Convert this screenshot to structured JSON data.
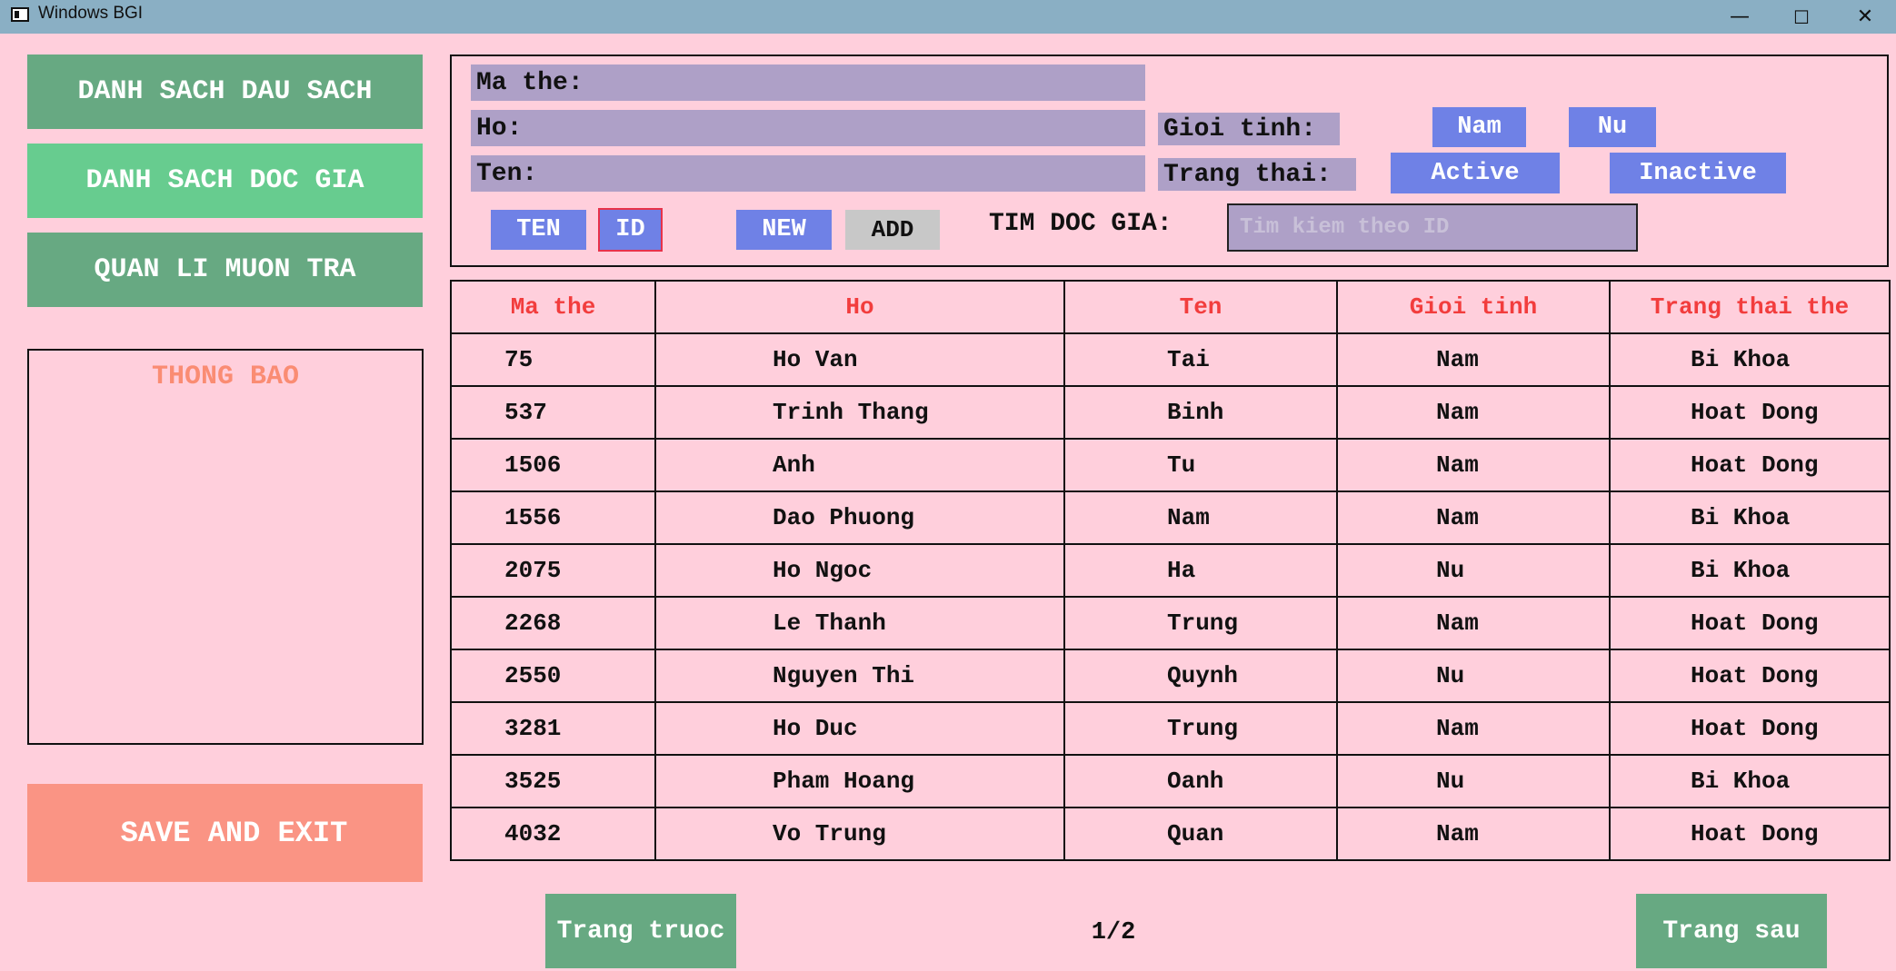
{
  "window": {
    "title": "Windows BGI",
    "minimize": "—",
    "maximize": "☐",
    "close": "✕"
  },
  "sidebar": {
    "nav": [
      "DANH SACH DAU SACH",
      "DANH SACH DOC GIA",
      "QUAN LI MUON TRA"
    ],
    "notify_title": "THONG BAO",
    "save_exit": "SAVE AND EXIT"
  },
  "form": {
    "ma_the_label": "Ma the:",
    "ho_label": "Ho:",
    "ten_label": "Ten:",
    "gioi_tinh_label": "Gioi tinh:",
    "nam": "Nam",
    "nu": "Nu",
    "trang_thai_label": "Trang thai:",
    "active": "Active",
    "inactive": "Inactive",
    "sort_ten": "TEN",
    "sort_id": "ID",
    "new": "NEW",
    "add": "ADD",
    "search_label": "TIM DOC GIA:",
    "search_placeholder": "Tim kiem theo ID"
  },
  "table": {
    "headers": [
      "Ma the",
      "Ho",
      "Ten",
      "Gioi tinh",
      "Trang thai the"
    ],
    "rows": [
      [
        "75",
        "Ho Van",
        "Tai",
        "Nam",
        "Bi Khoa"
      ],
      [
        "537",
        "Trinh Thang",
        "Binh",
        "Nam",
        "Hoat Dong"
      ],
      [
        "1506",
        "Anh",
        "Tu",
        "Nam",
        "Hoat Dong"
      ],
      [
        "1556",
        "Dao Phuong",
        "Nam",
        "Nam",
        "Bi Khoa"
      ],
      [
        "2075",
        "Ho Ngoc",
        "Ha",
        "Nu",
        "Bi Khoa"
      ],
      [
        "2268",
        "Le Thanh",
        "Trung",
        "Nam",
        "Hoat Dong"
      ],
      [
        "2550",
        "Nguyen Thi",
        "Quynh",
        "Nu",
        "Hoat Dong"
      ],
      [
        "3281",
        "Ho Duc",
        "Trung",
        "Nam",
        "Hoat Dong"
      ],
      [
        "3525",
        "Pham Hoang",
        "Oanh",
        "Nu",
        "Bi Khoa"
      ],
      [
        "4032",
        "Vo Trung",
        "Quan",
        "Nam",
        "Hoat Dong"
      ]
    ]
  },
  "pagination": {
    "prev": "Trang truoc",
    "page": "1/2",
    "next": "Trang sau"
  },
  "colors": {
    "background": "#ffcfdc",
    "nav_green": "#67a982",
    "nav_active": "#67cc8f",
    "button_blue": "#6f81e6",
    "field_purple": "#aea0c7",
    "header_red": "#f23d3d",
    "save_salmon": "#fa9484"
  }
}
